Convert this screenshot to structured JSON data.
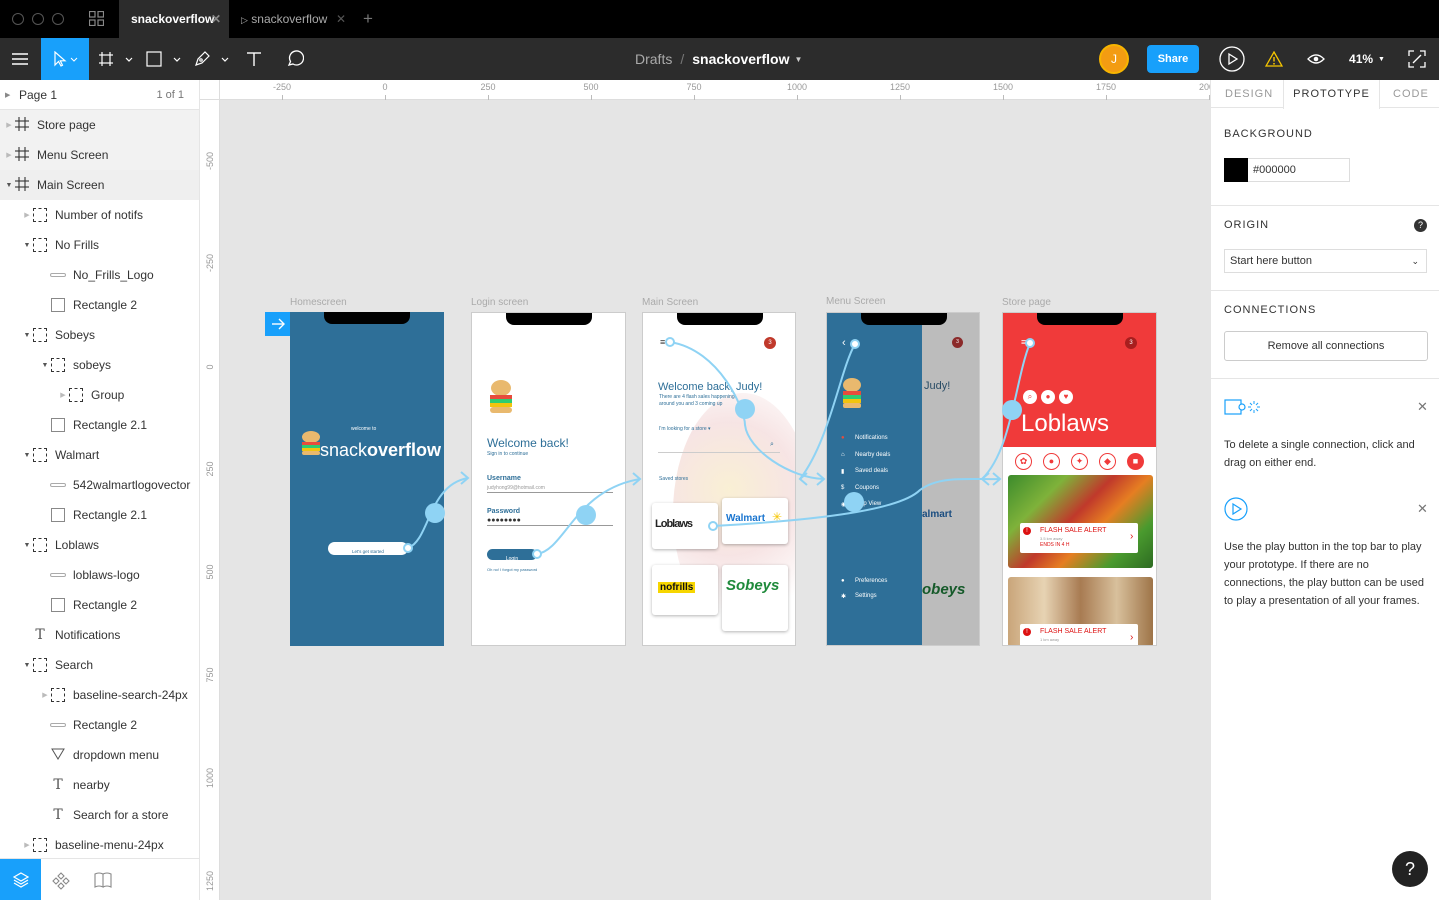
{
  "tabs": [
    {
      "label": "snackoverflow",
      "active": true
    },
    {
      "label": "snackoverflow",
      "active": false
    }
  ],
  "toolbar": {
    "breadcrumb_parent": "Drafts",
    "breadcrumb_sep": "/",
    "file_name": "snackoverflow",
    "avatar_initial": "J",
    "share_label": "Share",
    "zoom": "41%"
  },
  "pages": {
    "current": "Page 1",
    "count": "1 of 1"
  },
  "layers": [
    {
      "label": "Store page",
      "icon": "frame",
      "depth": 0,
      "caret": "right"
    },
    {
      "label": "Menu Screen",
      "icon": "frame",
      "depth": 0,
      "caret": "right"
    },
    {
      "label": "Main Screen",
      "icon": "frame",
      "depth": 0,
      "caret": "down"
    },
    {
      "label": "Number of notifs",
      "icon": "group",
      "depth": 1,
      "caret": "right"
    },
    {
      "label": "No Frills",
      "icon": "group",
      "depth": 1,
      "caret": "down"
    },
    {
      "label": "No_Frills_Logo",
      "icon": "line",
      "depth": 2,
      "caret": ""
    },
    {
      "label": "Rectangle 2",
      "icon": "rect",
      "depth": 2,
      "caret": ""
    },
    {
      "label": "Sobeys",
      "icon": "group",
      "depth": 1,
      "caret": "down"
    },
    {
      "label": "sobeys",
      "icon": "group",
      "depth": 2,
      "caret": "down"
    },
    {
      "label": "Group",
      "icon": "group",
      "depth": 3,
      "caret": "right"
    },
    {
      "label": "Rectangle 2.1",
      "icon": "rect",
      "depth": 2,
      "caret": ""
    },
    {
      "label": "Walmart",
      "icon": "group",
      "depth": 1,
      "caret": "down"
    },
    {
      "label": "542walmartlogovector",
      "icon": "line",
      "depth": 2,
      "caret": ""
    },
    {
      "label": "Rectangle 2.1",
      "icon": "rect",
      "depth": 2,
      "caret": ""
    },
    {
      "label": "Loblaws",
      "icon": "group",
      "depth": 1,
      "caret": "down"
    },
    {
      "label": "loblaws-logo",
      "icon": "line",
      "depth": 2,
      "caret": ""
    },
    {
      "label": "Rectangle 2",
      "icon": "rect",
      "depth": 2,
      "caret": ""
    },
    {
      "label": "Notifications",
      "icon": "text",
      "depth": 1,
      "caret": ""
    },
    {
      "label": "Search",
      "icon": "group",
      "depth": 1,
      "caret": "down"
    },
    {
      "label": "baseline-search-24px",
      "icon": "group",
      "depth": 2,
      "caret": "right"
    },
    {
      "label": "Rectangle 2",
      "icon": "line",
      "depth": 2,
      "caret": ""
    },
    {
      "label": "dropdown menu",
      "icon": "triangle",
      "depth": 2,
      "caret": ""
    },
    {
      "label": "nearby",
      "icon": "text",
      "depth": 2,
      "caret": ""
    },
    {
      "label": "Search for a store",
      "icon": "text",
      "depth": 2,
      "caret": ""
    },
    {
      "label": "baseline-menu-24px",
      "icon": "group",
      "depth": 1,
      "caret": "right"
    }
  ],
  "ruler_h": [
    "-250",
    "0",
    "250",
    "500",
    "750",
    "1000",
    "1250",
    "1500",
    "1750",
    "2000"
  ],
  "ruler_v": [
    "-500",
    "-250",
    "0",
    "250",
    "500",
    "750",
    "1000",
    "1250"
  ],
  "frames": {
    "home": {
      "label": "Homescreen",
      "welcome": "welcome to",
      "brand_a": "snack",
      "brand_b": "overflow",
      "cta": "Let's get started"
    },
    "login": {
      "label": "Login screen",
      "title": "Welcome back!",
      "subtitle": "Sign in to continue",
      "user_label": "Username",
      "user_value": "judyhong99@hotmail.com",
      "pass_label": "Password",
      "pass_value": "●●●●●●●●",
      "login_btn": "Login",
      "forgot": "Oh no! I forgot my password"
    },
    "main": {
      "label": "Main Screen",
      "badge": "3",
      "title": "Welcome back, Judy!",
      "line1": "There are 4 flash sales happening",
      "line2": "around you and 3 coming up",
      "search": "I'm looking for a store ▾",
      "saved": "Saved stores",
      "walmart": "Walmart",
      "loblaws": "Loblaws",
      "nofrills": "nofrills",
      "sobeys": "Sobeys"
    },
    "menu": {
      "label": "Menu Screen",
      "badge": "3",
      "peek": "Judy!",
      "items": [
        "Notifications",
        "Nearby deals",
        "Saved deals",
        "Coupons",
        "Map View"
      ],
      "bottom": [
        "Preferences",
        "Settings"
      ],
      "peek_walmart": "almart",
      "peek_sobeys": "obeys"
    },
    "store": {
      "label": "Store page",
      "badge": "3",
      "name": "Loblaws",
      "alert": "FLASH SALE ALERT",
      "alert_sub": "3.5 km away",
      "ends": "ENDS IN 4 H",
      "alert2_sub": "1 km away"
    }
  },
  "right": {
    "tabs": [
      "DESIGN",
      "PROTOTYPE",
      "CODE"
    ],
    "background_title": "BACKGROUND",
    "background_hex": "#000000",
    "background_color": "#000000",
    "origin_title": "ORIGIN",
    "origin_value": "Start here button",
    "connections_title": "CONNECTIONS",
    "remove_btn": "Remove all connections",
    "tip1": "To delete a single connection, click and drag on either end.",
    "tip2": "Use the play button in the top bar to play your prototype. If there are no connections, the play button can be used to play a presentation of all your frames."
  },
  "colors": {
    "accent": "#18a0fb",
    "frame_blue": "#2e6f98",
    "store_red": "#f03a3a",
    "connector": "#8fd3f4"
  }
}
